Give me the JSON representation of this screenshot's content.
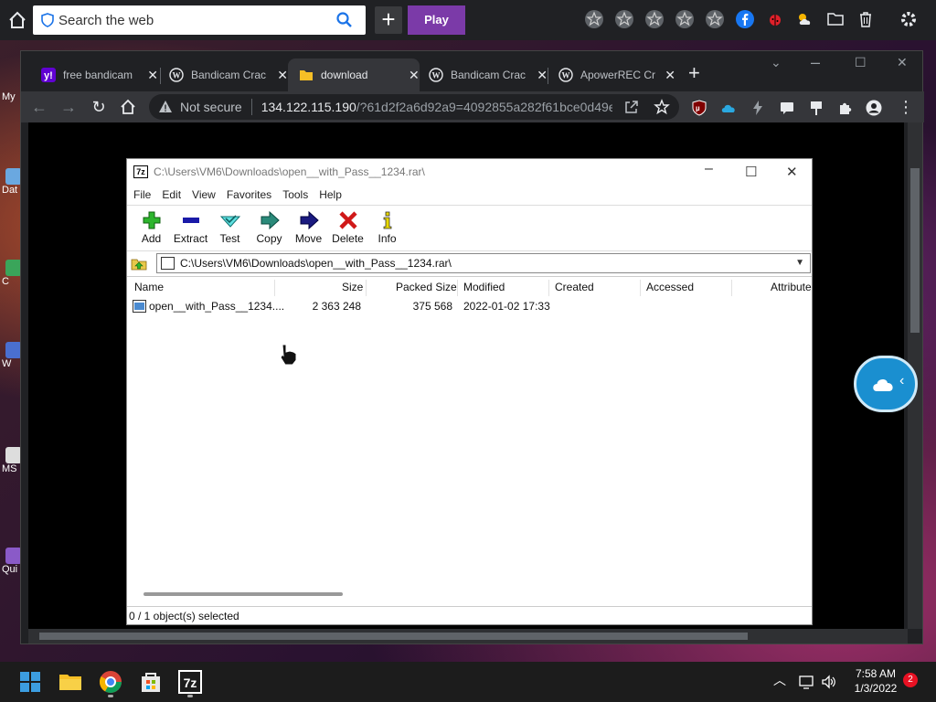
{
  "topbar": {
    "search_placeholder": "Search the web",
    "plus_label": "+",
    "play_label": "Play"
  },
  "desktop": {
    "icons": [
      "My",
      "Dat",
      "C",
      "W",
      "MS",
      "Qui"
    ]
  },
  "browser": {
    "tabs": [
      {
        "label": "free bandicam",
        "icon": "yahoo-icon"
      },
      {
        "label": "Bandicam Crac",
        "icon": "wordpress-icon"
      },
      {
        "label": "download",
        "icon": "folder-icon"
      },
      {
        "label": "Bandicam Crac",
        "icon": "wordpress-icon"
      },
      {
        "label": "ApowerREC Cr",
        "icon": "wordpress-icon"
      }
    ],
    "close_glyph": "✕",
    "new_tab": "+",
    "not_secure": "Not secure",
    "url_host": "134.122.115.190",
    "url_path": "/?61d2f2a6d92a9=4092855a282f61bce0d49e..."
  },
  "zip": {
    "title": "C:\\Users\\VM6\\Downloads\\open__with_Pass__1234.rar\\",
    "logo_text": "7z",
    "menu": [
      "File",
      "Edit",
      "View",
      "Favorites",
      "Tools",
      "Help"
    ],
    "tools": [
      "Add",
      "Extract",
      "Test",
      "Copy",
      "Move",
      "Delete",
      "Info"
    ],
    "address": "C:\\Users\\VM6\\Downloads\\open__with_Pass__1234.rar\\",
    "columns": [
      "Name",
      "Size",
      "Packed Size",
      "Modified",
      "Created",
      "Accessed",
      "Attribute"
    ],
    "rows": [
      {
        "name": "open__with_Pass__1234....",
        "size": "2 363 248",
        "packed": "375 568",
        "modified": "2022-01-02 17:33",
        "created": "",
        "accessed": "",
        "attr": ""
      }
    ],
    "status": "0 / 1 object(s) selected"
  },
  "taskbar": {
    "time": "7:58 AM",
    "date": "1/3/2022",
    "notifications": "2",
    "app_7z": "7z"
  },
  "colors": {
    "play": "#7b3aa8",
    "add_green": "#2db52d",
    "extract_blue": "#1a1aa8",
    "delete_red": "#d01818"
  }
}
